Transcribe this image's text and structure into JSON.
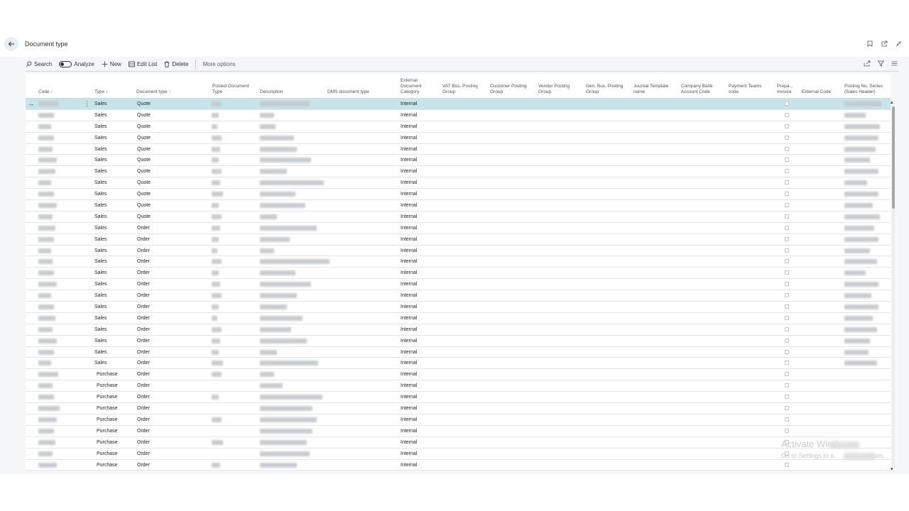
{
  "page": {
    "title": "Document type"
  },
  "toolbar": {
    "search": "Search",
    "analyze": "Analyze",
    "new": "New",
    "edit_list": "Edit List",
    "delete": "Delete",
    "more": "More options"
  },
  "columns": {
    "code": "Code ↑",
    "type": "Type ↑",
    "doctype": "Document type ↑",
    "posted": "Posted Document\nType",
    "desc": "Description",
    "dms": "DMS document type",
    "ext_cat": "External\nDocument\nCategory",
    "vat": "VAT Bus. Posting\nGroup",
    "cust": "Customer Posting\nGroup",
    "vendor": "Vendor Posting\nGroup",
    "gen": "Gen. Bus. Posting\nGroup",
    "journal": "Journal Template\nname",
    "bank": "Company Bank\nAccount Code",
    "pay": "Payment Teams\ncode",
    "prepa": "Prepa...\nInvoice",
    "ext_code": "External Code",
    "series": "Posting No. Series\n(Sales Header)"
  },
  "rows": [
    {
      "type": "Sales",
      "doc": "Quote",
      "cat": "Internal"
    },
    {
      "type": "Sales",
      "doc": "Quote",
      "cat": "Internal"
    },
    {
      "type": "Sales",
      "doc": "Quote",
      "cat": "Internal"
    },
    {
      "type": "Sales",
      "doc": "Quote",
      "cat": "Internal"
    },
    {
      "type": "Sales",
      "doc": "Quote",
      "cat": "Internal"
    },
    {
      "type": "Sales",
      "doc": "Quote",
      "cat": "Internal"
    },
    {
      "type": "Sales",
      "doc": "Quote",
      "cat": "Internal"
    },
    {
      "type": "Sales",
      "doc": "Quote",
      "cat": "Internal"
    },
    {
      "type": "Sales",
      "doc": "Quote",
      "cat": "Internal"
    },
    {
      "type": "Sales",
      "doc": "Quote",
      "cat": "Internal"
    },
    {
      "type": "Sales",
      "doc": "Quote",
      "cat": "Internal"
    },
    {
      "type": "Sales",
      "doc": "Order",
      "cat": "Internal"
    },
    {
      "type": "Sales",
      "doc": "Order",
      "cat": "Internal"
    },
    {
      "type": "Sales",
      "doc": "Order",
      "cat": "Internal"
    },
    {
      "type": "Sales",
      "doc": "Order",
      "cat": "Internal"
    },
    {
      "type": "Sales",
      "doc": "Order",
      "cat": "Internal"
    },
    {
      "type": "Sales",
      "doc": "Order",
      "cat": "Internal"
    },
    {
      "type": "Sales",
      "doc": "Order",
      "cat": "Internal"
    },
    {
      "type": "Sales",
      "doc": "Order",
      "cat": "Internal"
    },
    {
      "type": "Sales",
      "doc": "Order",
      "cat": "Internal"
    },
    {
      "type": "Sales",
      "doc": "Order",
      "cat": "Internal"
    },
    {
      "type": "Sales",
      "doc": "Order",
      "cat": "Internal"
    },
    {
      "type": "Sales",
      "doc": "Order",
      "cat": "Internal"
    },
    {
      "type": "Sales",
      "doc": "Order",
      "cat": "Internal"
    },
    {
      "type": "Purchase",
      "doc": "Order",
      "cat": "Internal"
    },
    {
      "type": "Purchase",
      "doc": "Order",
      "cat": "Internal"
    },
    {
      "type": "Purchase",
      "doc": "Order",
      "cat": "Internal"
    },
    {
      "type": "Purchase",
      "doc": "Order",
      "cat": "Internal"
    },
    {
      "type": "Purchase",
      "doc": "Order",
      "cat": "Internal"
    },
    {
      "type": "Purchase",
      "doc": "Order",
      "cat": "Internal"
    },
    {
      "type": "Purchase",
      "doc": "Order",
      "cat": "Internal"
    },
    {
      "type": "Purchase",
      "doc": "Order",
      "cat": "Internal"
    },
    {
      "type": "Purchase",
      "doc": "Order",
      "cat": "Internal"
    }
  ],
  "watermark": {
    "line1": "Activate Wind",
    "line2": "Go to Settings to a",
    "line3": "dows."
  }
}
